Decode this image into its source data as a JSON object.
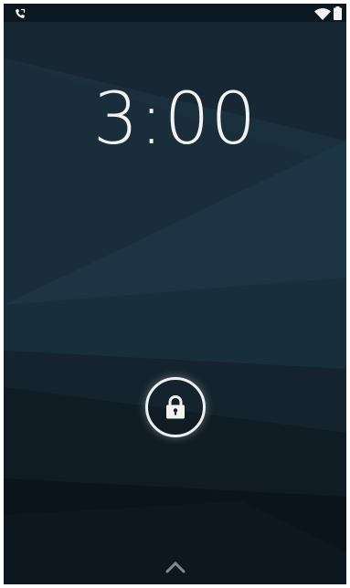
{
  "status_bar": {
    "left_icon": "phone-call-icon",
    "right_icons": [
      "wifi-icon",
      "battery-icon"
    ]
  },
  "clock": {
    "time": "3:00"
  },
  "lock_button": {
    "icon": "padlock-icon"
  },
  "unlock_hint": {
    "icon": "chevron-up-icon"
  },
  "colors": {
    "background": "#0f1a22",
    "foreground": "#f2f2f2",
    "wallpaper_light": "#1d3544"
  }
}
